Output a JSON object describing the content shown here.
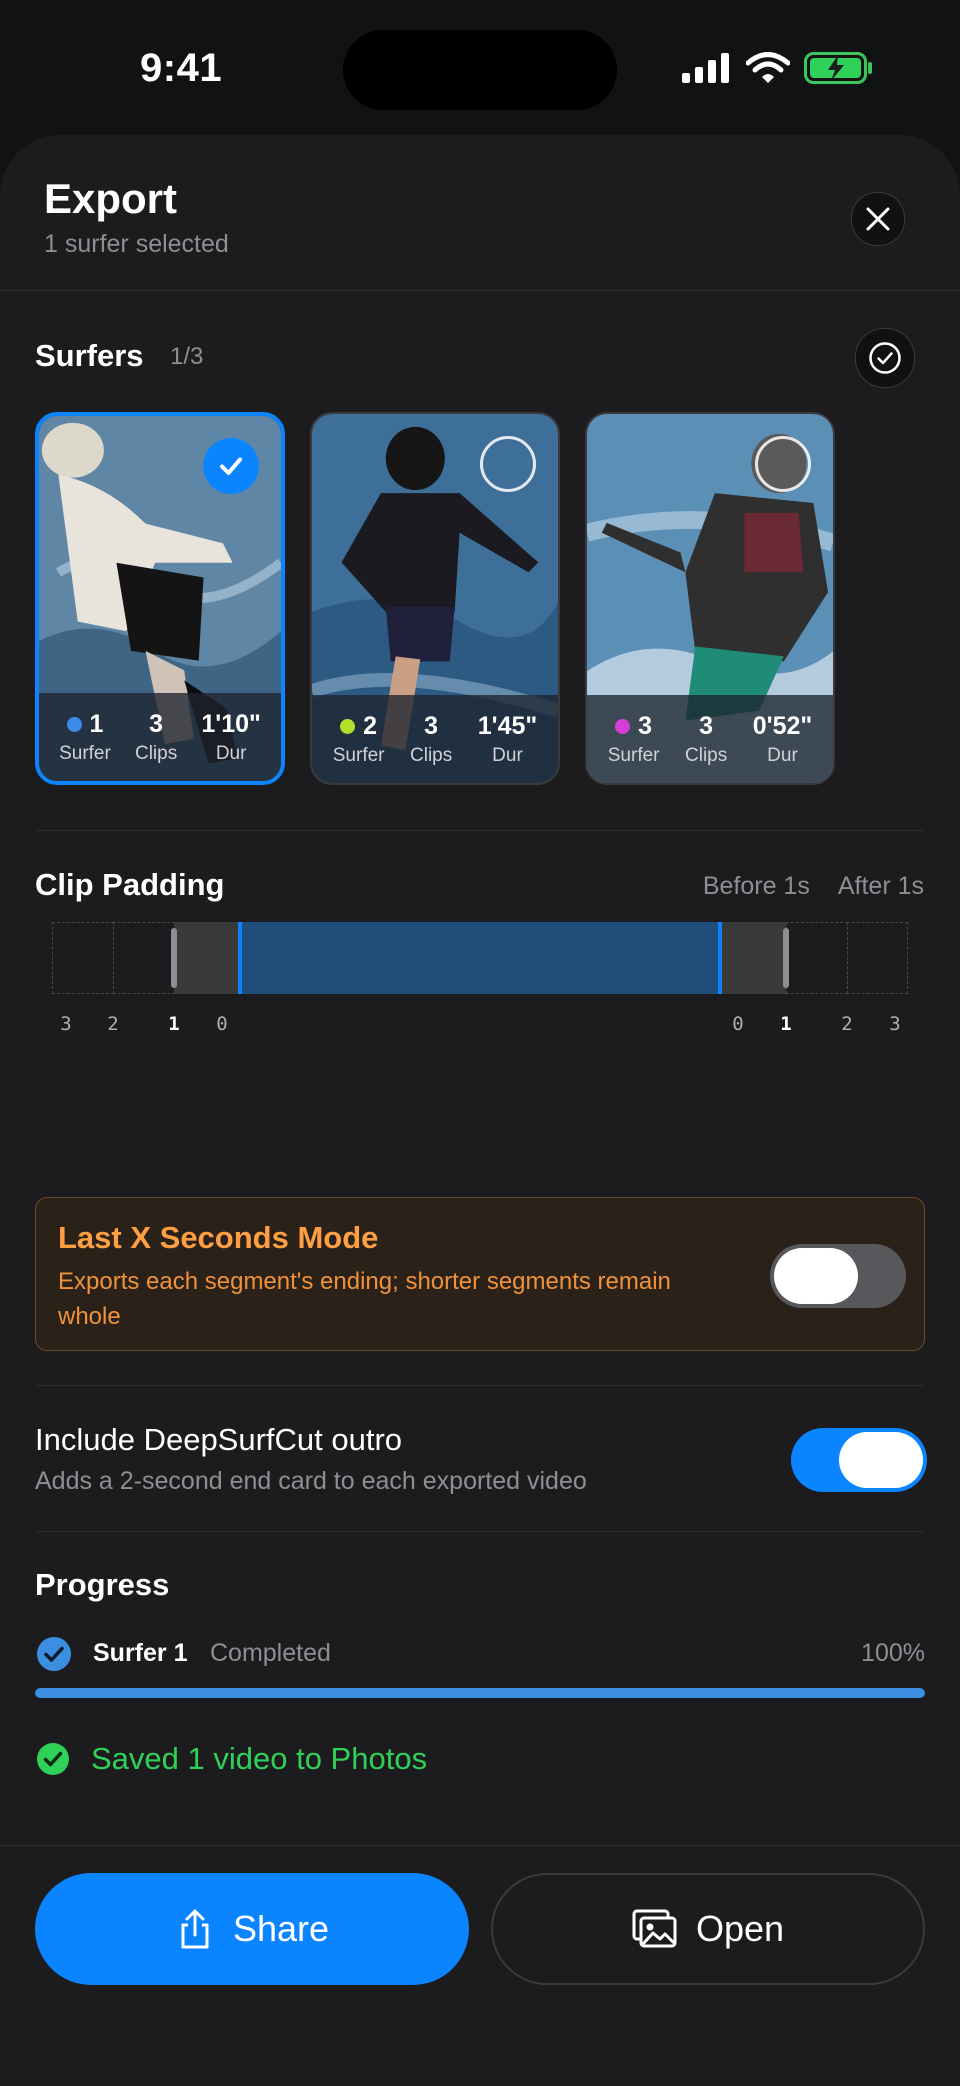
{
  "status": {
    "time": "9:41"
  },
  "header": {
    "title": "Export",
    "subtitle": "1 surfer selected"
  },
  "surfers": {
    "title": "Surfers",
    "count": "1/3",
    "cards": [
      {
        "num": "1",
        "clips": "3",
        "dur": "1'10\"",
        "dot_color": "#3b8bea",
        "selected": true
      },
      {
        "num": "2",
        "clips": "3",
        "dur": "1'45\"",
        "dot_color": "#b4e02a",
        "selected": false
      },
      {
        "num": "3",
        "clips": "3",
        "dur": "0'52\"",
        "dot_color": "#d63fd6",
        "selected": false
      }
    ],
    "labels": {
      "surfer": "Surfer",
      "clips": "Clips",
      "dur": "Dur"
    }
  },
  "padding": {
    "title": "Clip Padding",
    "before": "Before 1s",
    "after": "After 1s",
    "ticks_left": [
      "3",
      "2",
      "1",
      "0"
    ],
    "ticks_right": [
      "0",
      "1",
      "2",
      "3"
    ]
  },
  "lastx": {
    "title": "Last X Seconds Mode",
    "desc": "Exports each segment's ending; shorter segments remain whole",
    "enabled": false
  },
  "outro": {
    "title": "Include DeepSurfCut outro",
    "desc": "Adds a 2-second end card to each exported video",
    "enabled": true
  },
  "progress": {
    "title": "Progress",
    "item_name": "Surfer 1",
    "item_status": "Completed",
    "percent_label": "100%",
    "percent": 100,
    "saved_message": "Saved 1 video to Photos"
  },
  "buttons": {
    "share": "Share",
    "open": "Open"
  },
  "colors": {
    "accent": "#0a84ff",
    "success": "#30d158",
    "warning": "#ff9f43"
  }
}
